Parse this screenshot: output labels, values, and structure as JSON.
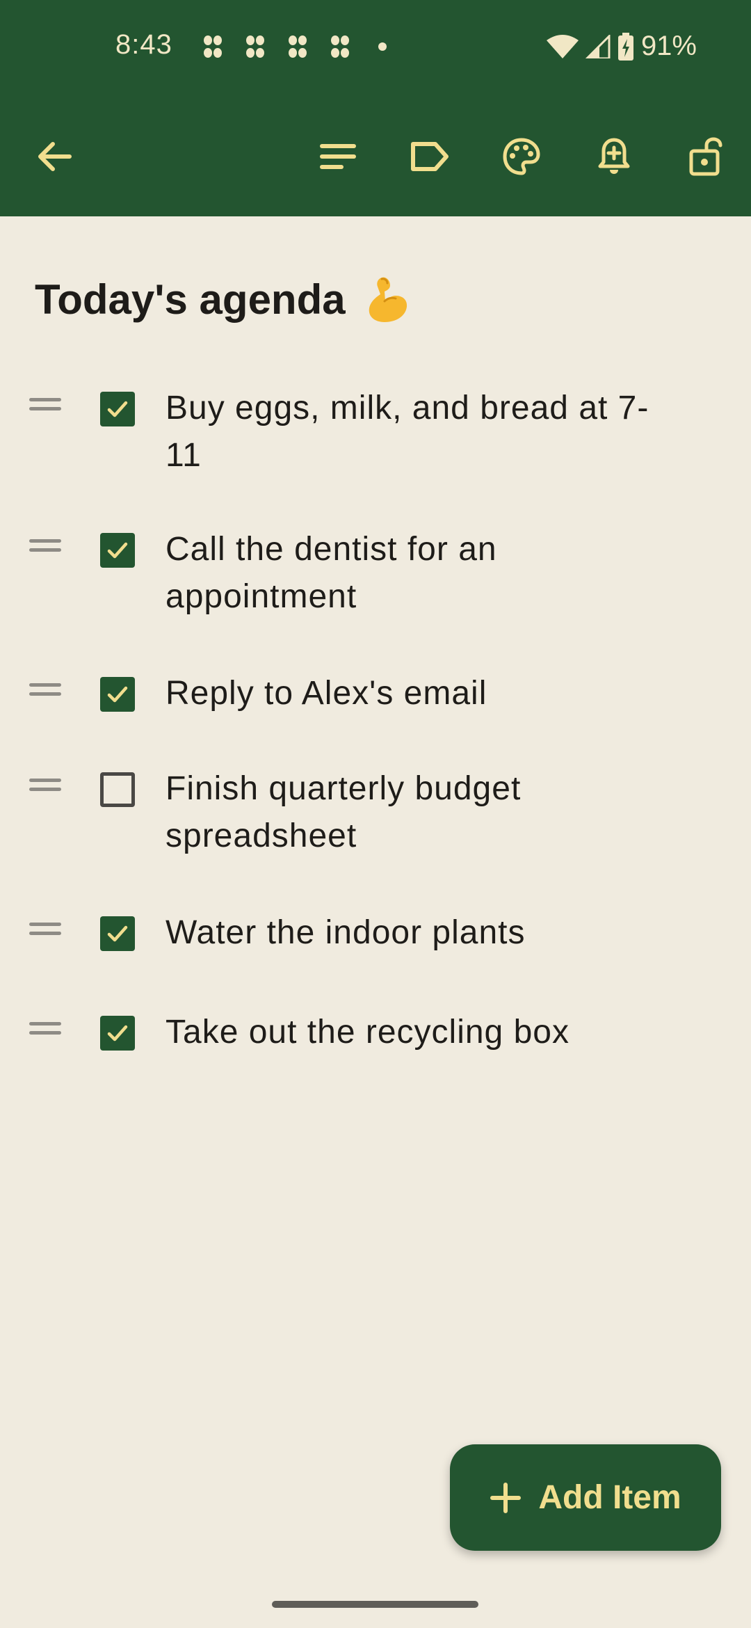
{
  "status_bar": {
    "time": "8:43",
    "battery_percent": "91%",
    "notification_icons": [
      "app-notification-icon",
      "app-notification-icon",
      "app-notification-icon",
      "app-notification-icon"
    ],
    "more_notifications": "dot-icon",
    "wifi": "wifi-icon",
    "signal": "cell-signal-icon",
    "battery": "battery-charging-icon"
  },
  "toolbar": {
    "back": "arrow-left-icon",
    "format": "text-format-icon",
    "label": "label-icon",
    "color": "palette-icon",
    "reminder": "add-reminder-icon",
    "lock": "unlock-icon"
  },
  "note": {
    "title": "Today's agenda",
    "title_emoji": "flexed-biceps-emoji",
    "items": [
      {
        "text": "Buy eggs, milk, and bread at 7-11",
        "checked": true
      },
      {
        "text": "Call the dentist for an appointment",
        "checked": true
      },
      {
        "text": "Reply to Alex's email",
        "checked": true
      },
      {
        "text": "Finish quarterly budget spreadsheet",
        "checked": false
      },
      {
        "text": "Water the indoor plants",
        "checked": true
      },
      {
        "text": "Take out the recycling box",
        "checked": true
      }
    ]
  },
  "fab": {
    "label": "Add Item",
    "icon": "plus-icon"
  },
  "colors": {
    "primary": "#235530",
    "background": "#F0EBDF",
    "accent": "#F1DE8E",
    "text": "#1E1C19"
  }
}
